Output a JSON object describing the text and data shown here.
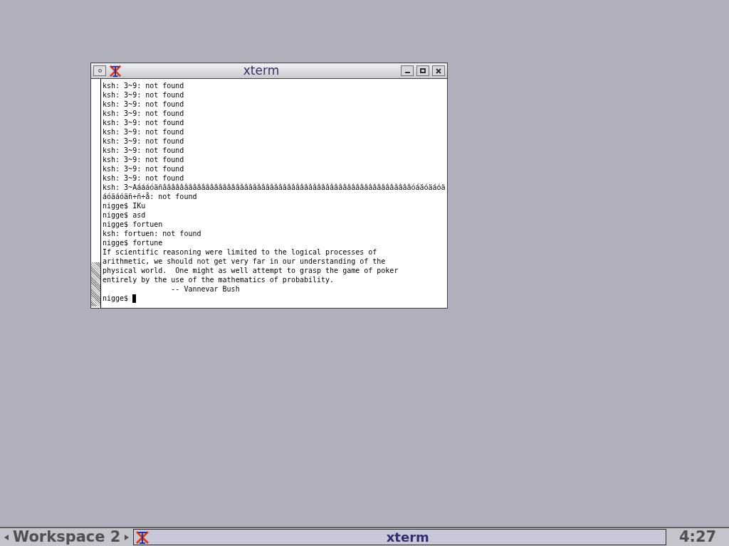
{
  "window": {
    "title": "xterm"
  },
  "terminal": {
    "lines": [
      "ksh: 3~9: not found",
      "ksh: 3~9: not found",
      "ksh: 3~9: not found",
      "ksh: 3~9: not found",
      "ksh: 3~9: not found",
      "ksh: 3~9: not found",
      "ksh: 3~9: not found",
      "ksh: 3~9: not found",
      "ksh: 3~9: not found",
      "ksh: 3~9: not found",
      "ksh: 3~9: not found",
      "ksh: 3~Aáááóäñââââââââââââââââââââââââââââââââââââââââââââââââââââââââââóáäóäáóä",
      "áóäáóäñ÷ñ÷å: not found",
      "nigge$ IKu",
      "nigge$ asd",
      "nigge$ fortuen",
      "ksh: fortuen: not found",
      "nigge$ fortune",
      "If scientific reasoning were limited to the logical processes of",
      "arithmetic, we should not get very far in our understanding of the",
      "physical world.  One might as well attempt to grasp the game of poker",
      "entirely by the use of the mathematics of probability.",
      "                -- Vannevar Bush"
    ],
    "prompt": "nigge$ "
  },
  "taskbar": {
    "workspace": "Workspace 2",
    "tasks": [
      {
        "label": "xterm",
        "selected": true
      }
    ],
    "clock": "4:27"
  }
}
